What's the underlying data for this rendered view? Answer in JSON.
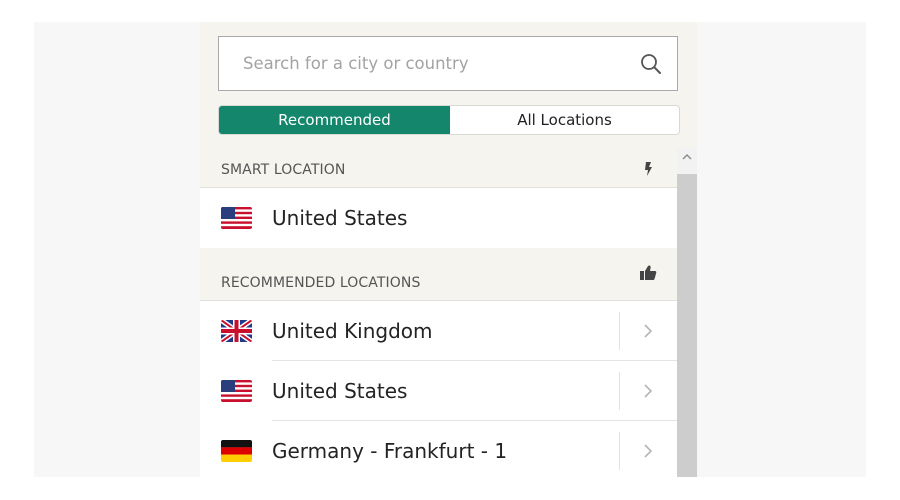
{
  "search": {
    "placeholder": "Search for a city or country",
    "icon": "search-icon"
  },
  "tabs": [
    {
      "label": "Recommended",
      "active": true
    },
    {
      "label": "All Locations",
      "active": false
    }
  ],
  "sections": {
    "smart": {
      "title": "SMART LOCATION",
      "icon": "lightning-icon",
      "location": {
        "name": "United States",
        "flag": "us-flag-icon"
      }
    },
    "recommended": {
      "title": "RECOMMENDED LOCATIONS",
      "icon": "thumbs-up-icon",
      "locations": [
        {
          "name": "United Kingdom",
          "flag": "uk-flag-icon"
        },
        {
          "name": "United States",
          "flag": "us-flag-icon"
        },
        {
          "name": "Germany - Frankfurt - 1",
          "flag": "de-flag-icon"
        }
      ]
    }
  },
  "colors": {
    "accent": "#13866b",
    "panel_background": "#f5f4ef",
    "row_background": "#ffffff",
    "scrollbar_thumb": "#cdcdcd"
  }
}
